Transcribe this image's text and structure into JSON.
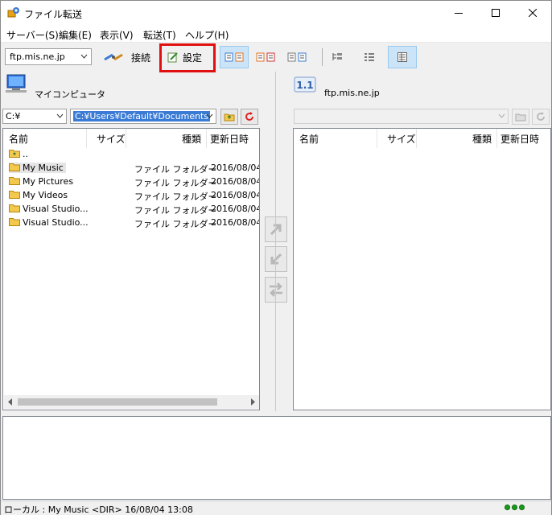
{
  "window": {
    "title": "ファイル転送"
  },
  "menu": [
    "サーバー(S)",
    "編集(E)",
    "表示(V)",
    "転送(T)",
    "ヘルプ(H)"
  ],
  "toolbar": {
    "server": "ftp.mis.ne.jp",
    "connect_label": "接続",
    "settings_label": "設定"
  },
  "local": {
    "title": "マイコンピュータ",
    "drive": "C:¥",
    "path": "C:¥Users¥Default¥Documents",
    "columns": [
      "名前",
      "サイズ",
      "種類",
      "更新日時"
    ],
    "rows": [
      {
        "name": "..",
        "size": "",
        "type": "",
        "date": ""
      },
      {
        "name": "My Music",
        "size": "",
        "type": "ファイル フォルダー",
        "date": "2016/08/04"
      },
      {
        "name": "My Pictures",
        "size": "",
        "type": "ファイル フォルダー",
        "date": "2016/08/04"
      },
      {
        "name": "My Videos",
        "size": "",
        "type": "ファイル フォルダー",
        "date": "2016/08/04"
      },
      {
        "name": "Visual Studio...",
        "size": "",
        "type": "ファイル フォルダー",
        "date": "2016/08/04"
      },
      {
        "name": "Visual Studio...",
        "size": "",
        "type": "ファイル フォルダー",
        "date": "2016/08/04"
      }
    ]
  },
  "remote": {
    "title": "ftp.mis.ne.jp",
    "path": "",
    "columns": [
      "名前",
      "サイズ",
      "種類",
      "更新日時"
    ],
    "rows": []
  },
  "status": {
    "text": "ローカル : My Music <DIR> 16/08/04 13:08"
  },
  "colors": {
    "highlight": "#e01010",
    "selection": "#3a7bd5",
    "status_ok": "#1a9b1a"
  }
}
